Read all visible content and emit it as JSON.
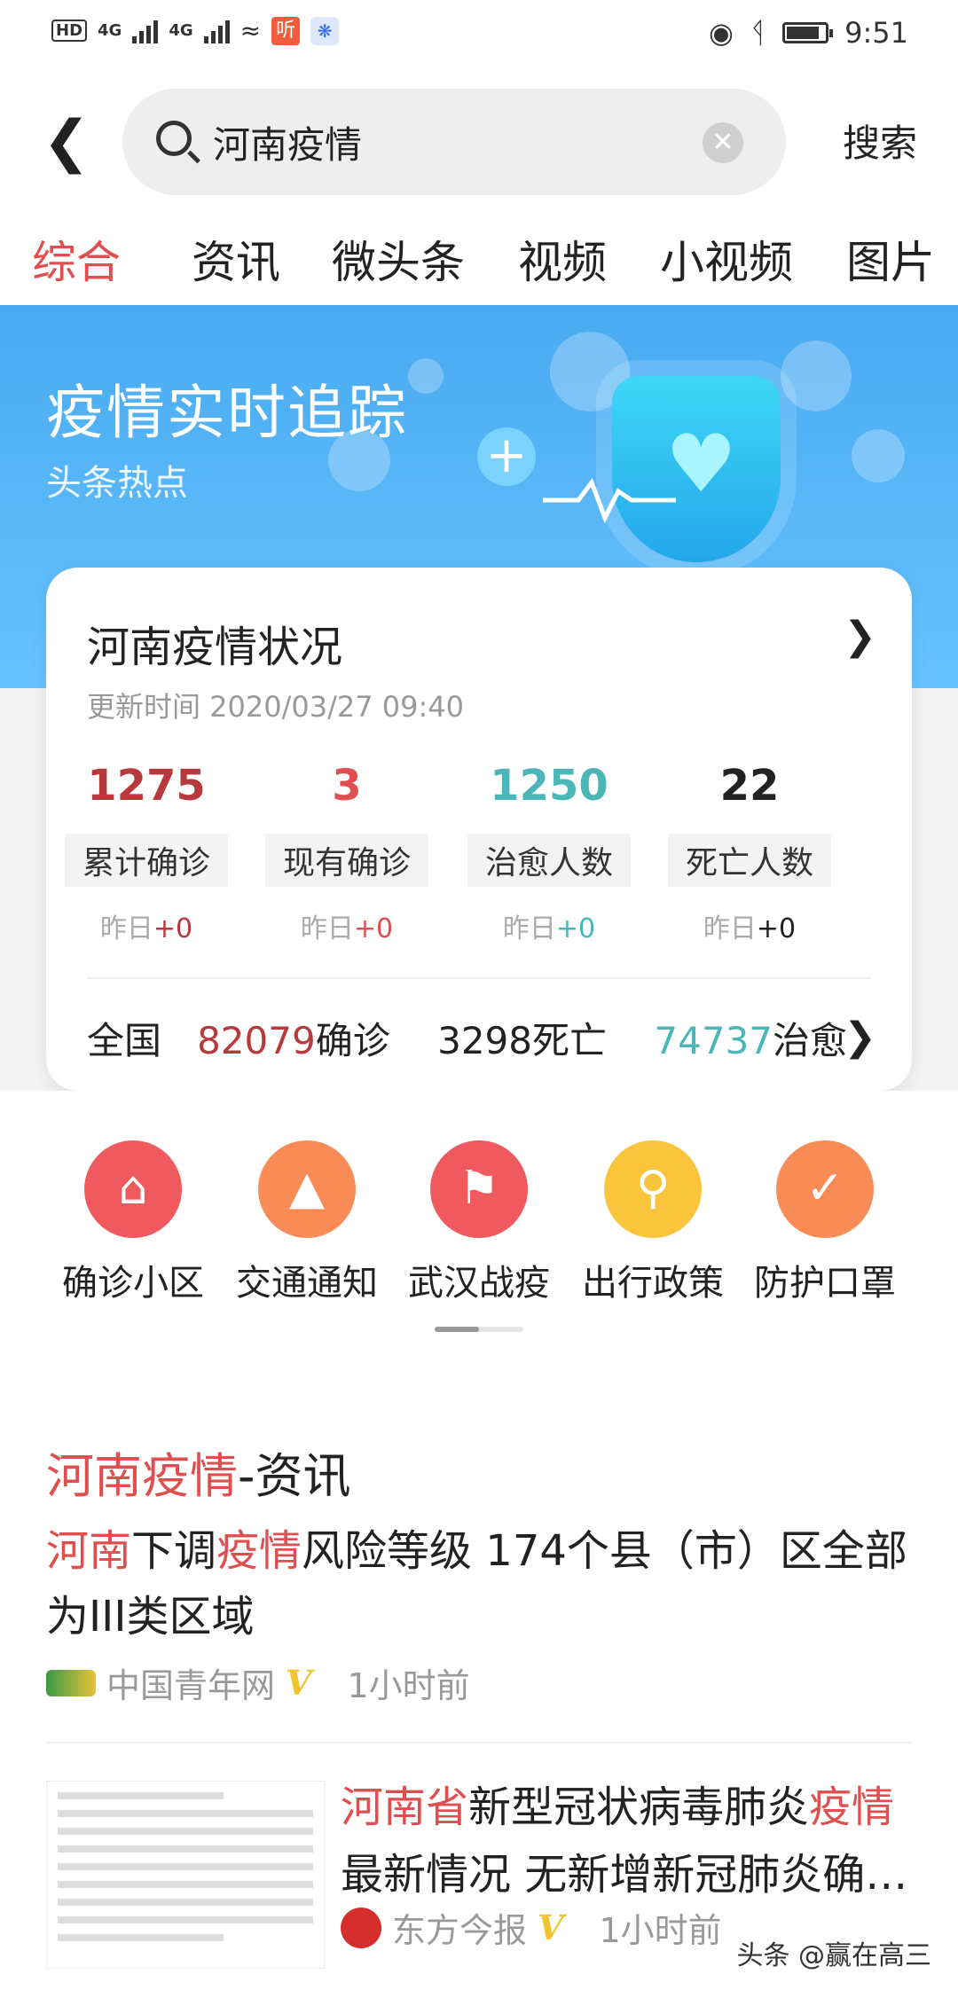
{
  "status": {
    "hd": "HD",
    "net1": "4G",
    "net2": "4G",
    "ting": "听",
    "baidu": "百度",
    "time": "9:51",
    "battery_level": 0.85
  },
  "search": {
    "query": "河南疫情",
    "button": "搜索"
  },
  "tabs": [
    "综合",
    "资讯",
    "微头条",
    "视频",
    "小视频",
    "图片"
  ],
  "banner": {
    "title": "疫情实时追踪",
    "subtitle": "头条热点"
  },
  "card": {
    "title": "河南疫情状况",
    "updated": "更新时间 2020/03/27 09:40",
    "stats": [
      {
        "num": "1275",
        "label": "累计确诊",
        "y_prefix": "昨日",
        "y_val": "+0",
        "color": "#b8393b"
      },
      {
        "num": "3",
        "label": "现有确诊",
        "y_prefix": "昨日",
        "y_val": "+0",
        "color": "#e04f4f"
      },
      {
        "num": "1250",
        "label": "治愈人数",
        "y_prefix": "昨日",
        "y_val": "+0",
        "color": "#4bb6b7"
      },
      {
        "num": "22",
        "label": "死亡人数",
        "y_prefix": "昨日",
        "y_val": "+0",
        "color": "#222222"
      }
    ],
    "national": {
      "label": "全国",
      "confirmed": "82079",
      "confirmed_unit": "确诊",
      "deaths": "3298",
      "deaths_unit": "死亡",
      "cured": "74737",
      "cured_unit": "治愈"
    }
  },
  "shortcuts": [
    {
      "label": "确诊小区",
      "icon": "home-location-icon",
      "color": "#f05a5e"
    },
    {
      "label": "交通通知",
      "icon": "car-icon",
      "color": "#f98c56"
    },
    {
      "label": "武汉战疫",
      "icon": "flag-icon",
      "color": "#f05a5e"
    },
    {
      "label": "出行政策",
      "icon": "search-icon",
      "color": "#fbc43d"
    },
    {
      "label": "防护口罩",
      "icon": "shield-check-icon",
      "color": "#f98c56"
    }
  ],
  "section": {
    "hl": "河南疫情",
    "rest": "-资讯"
  },
  "news1": {
    "p1": "河南",
    "p2": "下调",
    "p3": "疫情",
    "p4": "风险等级 174个县（市）区全部为III类区域",
    "source": "中国青年网",
    "time": "1小时前"
  },
  "news2": {
    "p1": "河南省",
    "p2": "新型冠状病毒肺炎",
    "p3": "疫情",
    "line2": "最新情况 无新增新冠肺炎确诊病例",
    "source": "东方今报",
    "time": "1小时前"
  },
  "watermark": "头条 @赢在高三"
}
